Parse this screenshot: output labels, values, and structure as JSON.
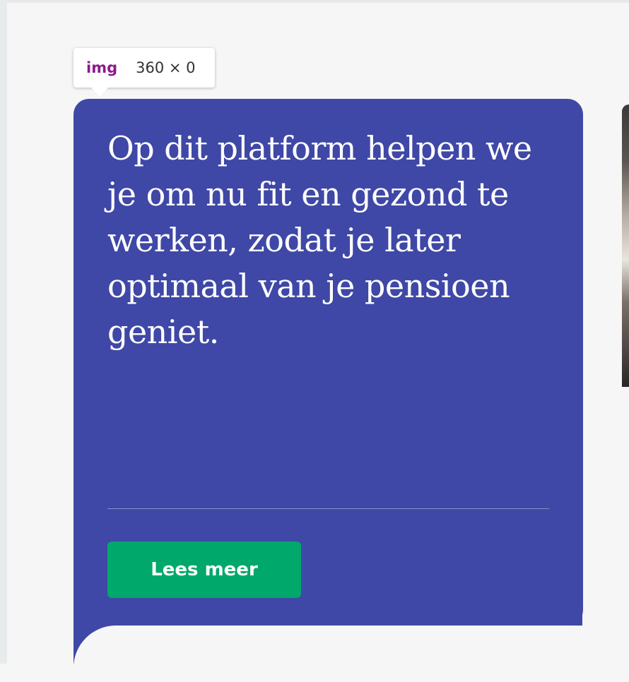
{
  "tooltip": {
    "tag": "img",
    "dimensions": "360 × 0"
  },
  "card": {
    "headline": "Op dit platform helpen we je om nu fit en gezond te werken, zodat je later optimaal van je pensioen geniet.",
    "cta_label": "Lees meer",
    "background_color": "#3f48a6",
    "cta_color": "#00a86b"
  }
}
